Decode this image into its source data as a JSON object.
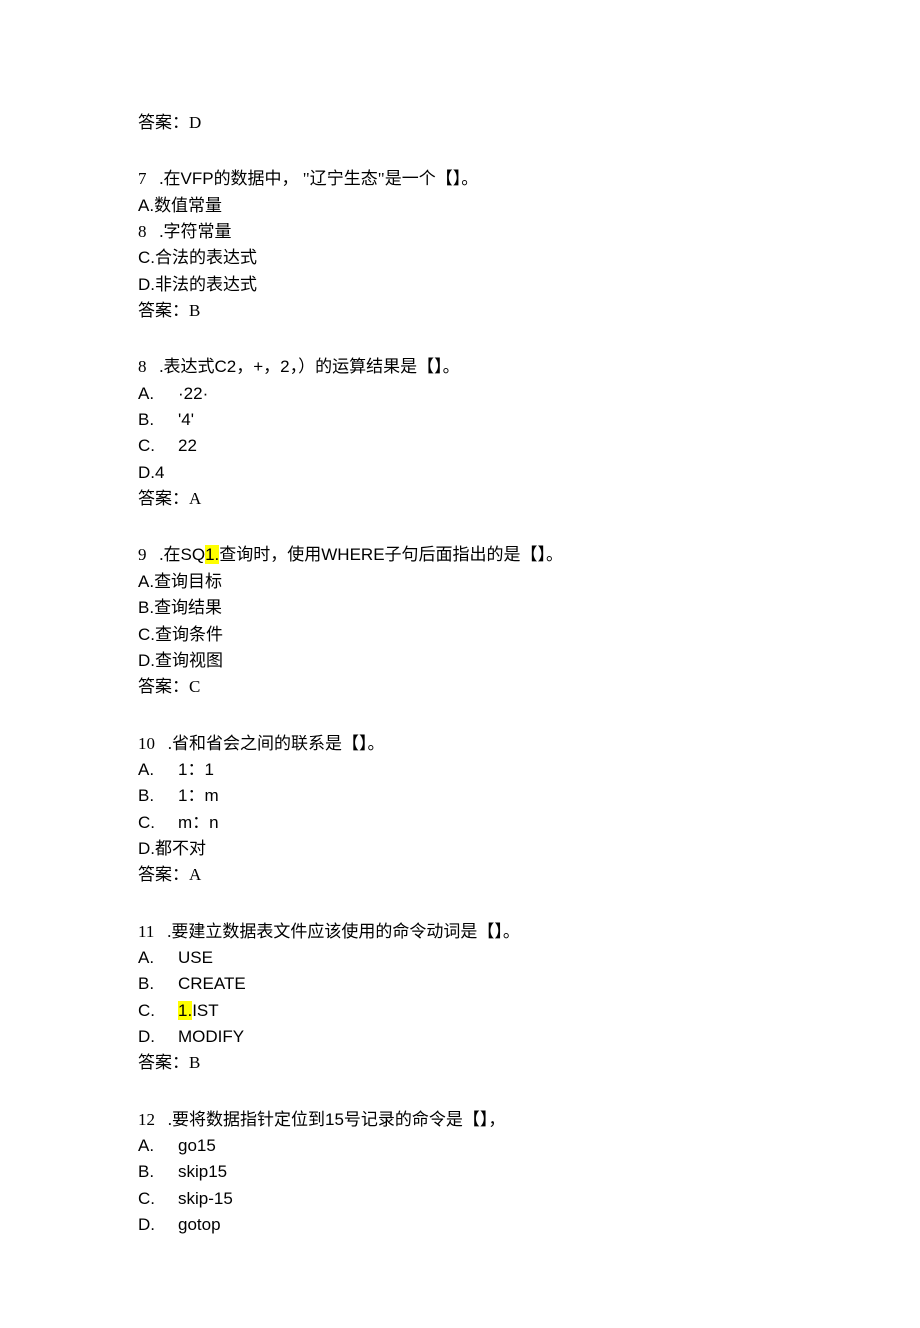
{
  "q6": {
    "answer_label": "答案：D"
  },
  "q7": {
    "stem_prefix": "7   .在",
    "stem_vfp": "VFP",
    "stem_suffix": "的数据中， \"辽宁生态\"是一个【】。",
    "A": "A.数值常量",
    "B": "8   .字符常量",
    "C": "C.合法的表达式",
    "D": "D.非法的表达式",
    "answer": "答案：B"
  },
  "q8": {
    "stem_prefix": "8   .表达式",
    "stem_expr": "C2，+，2，）",
    "stem_suffix": "的运算结果是【】。",
    "A_letter": "A.",
    "A_val": "·22·",
    "B_letter": "B.",
    "B_val": "'4'",
    "C_letter": "C.",
    "C_val": "22",
    "D": "D.4",
    "answer": "答案：A"
  },
  "q9": {
    "stem_prefix": "9   .在",
    "stem_sq": "SQ",
    "stem_hl": "1.",
    "stem_mid": "查询时，使用",
    "stem_where": "WHERE",
    "stem_suffix": "子句后面指出的是【】。",
    "A": "A.查询目标",
    "B": "B.查询结果",
    "C": "C.查询条件",
    "D": "D.查询视图",
    "answer": "答案：C"
  },
  "q10": {
    "stem": "10   .省和省会之间的联系是【】。",
    "A_letter": "A.",
    "A_val": "1：1",
    "B_letter": "B.",
    "B_val": "1：m",
    "C_letter": "C.",
    "C_val": "m：n",
    "D": "D.都不对",
    "answer": "答案：A"
  },
  "q11": {
    "stem": "11   .要建立数据表文件应该使用的命令动词是【】。",
    "A_letter": "A.",
    "A_val": "USE",
    "B_letter": "B.",
    "B_val": "CREATE",
    "C_letter": "C.",
    "C_hl": "1.",
    "C_val": "IST",
    "D_letter": "D.",
    "D_val": "MODIFY",
    "answer": "答案：B"
  },
  "q12": {
    "stem_prefix": "12   .要将数据指针定位到",
    "stem_num": "15",
    "stem_suffix": "号记录的命令是【】，",
    "A_letter": "A.",
    "A_val": "go15",
    "B_letter": "B.",
    "B_val": "skip15",
    "C_letter": "C.",
    "C_val": "skip-15",
    "D_letter": "D.",
    "D_val": "gotop"
  }
}
